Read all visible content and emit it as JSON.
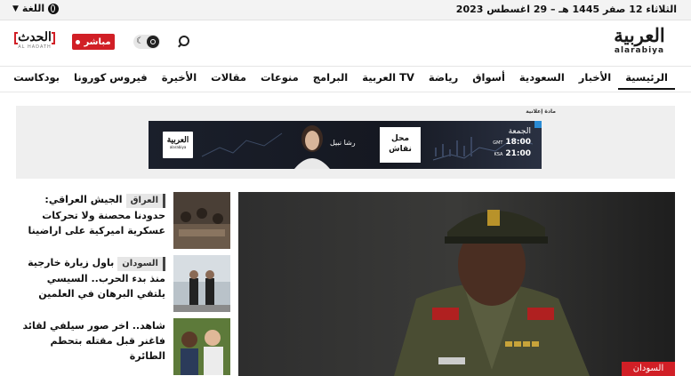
{
  "topbar": {
    "date": "الثلاثاء 12 صفر 1445 هـ – 29 اغسطس 2023",
    "language_label": "اللغة"
  },
  "header": {
    "logo_arabic": "العربية",
    "logo_latin": "alarabiya",
    "live_label": "مباشر",
    "hadath_arabic": "الحدث",
    "hadath_latin": "AL HADATH"
  },
  "nav": {
    "items": [
      {
        "label": "الرئيسية",
        "active": true
      },
      {
        "label": "الأخبار"
      },
      {
        "label": "السعودية"
      },
      {
        "label": "أسواق"
      },
      {
        "label": "رياضة"
      },
      {
        "label": "العربية TV"
      },
      {
        "label": "البرامج"
      },
      {
        "label": "منوعات"
      },
      {
        "label": "مقالات"
      },
      {
        "label": "الأخيرة"
      },
      {
        "label": "فيروس كورونا"
      },
      {
        "label": "بودكاست"
      }
    ]
  },
  "ad": {
    "label": "مادة إعلانية",
    "logo_arabic": "العربية",
    "logo_latin": "alarabiya",
    "tagline": "رشا نبيل",
    "program_line1": "محل",
    "program_line2": "نقاش",
    "day": "الجمعة",
    "time1": "18:00",
    "zone1": "GMT",
    "time2": "21:00",
    "zone2": "KSA"
  },
  "news": [
    {
      "tag": "العراق",
      "title": "الجيش العراقي: حدودنا محصنة ولا تحركات عسكرية اميركية على اراضينا"
    },
    {
      "tag": "السودان",
      "title": "باول زيارة خارجية منذ بدء الحرب.. السيسي يلتقي البرهان في العلمين"
    },
    {
      "tag": "",
      "title": "شاهد.. اخر صور سيلفي لقائد فاغنر قبل مقتله بتحطم الطائرة"
    }
  ],
  "hero": {
    "tag": "السودان"
  },
  "colors": {
    "accent_red": "#d11f26",
    "nav_text": "#111111",
    "topbar_bg": "#f3f3f3"
  }
}
